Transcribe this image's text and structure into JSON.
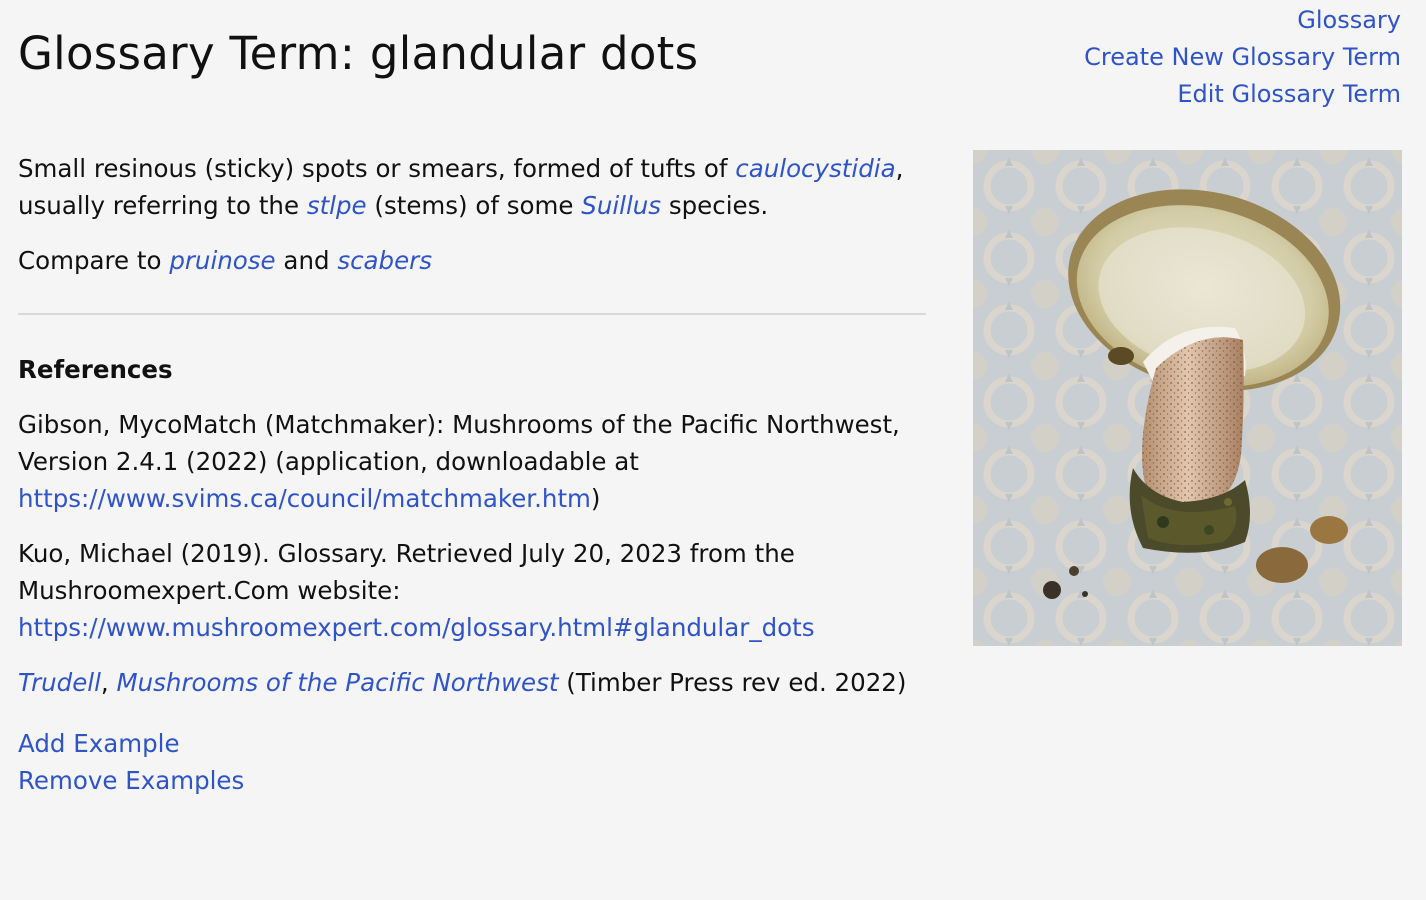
{
  "title": "Glossary Term: glandular dots",
  "nav": {
    "glossary": "Glossary",
    "create": "Create New Glossary Term",
    "edit": "Edit Glossary Term"
  },
  "definition": {
    "t1": "Small resinous (sticky) spots or smears, formed of tufts of ",
    "link_caulocystidia": "caulocystidia",
    "t2": ", usually referring to the ",
    "link_stipe": "stlpe",
    "t3": " (stems) of some ",
    "link_suillus": "Suillus",
    "t4": " species."
  },
  "compare": {
    "t1": "Compare to ",
    "link_pruinose": "pruinose",
    "t2": " and ",
    "link_scabers": "scabers"
  },
  "references": {
    "heading": "References",
    "ref1": {
      "text": "Gibson, MycoMatch (Matchmaker): Mushrooms of the Pacific Northwest, Version 2.4.1 (2022) (application, downloadable at ",
      "url": "https://www.svims.ca/council/matchmaker.htm",
      "tail": ")"
    },
    "ref2": {
      "text": "Kuo, Michael (2019). Glossary. Retrieved July 20, 2023 from the Mushroomexpert.Com website: ",
      "url": "https://www.mushroomexpert.com/glossary.html#glandular_dots"
    },
    "ref3": {
      "author": "Trudell",
      "sep": ", ",
      "book": "Mushrooms of the Pacific Northwest",
      "tail": " (Timber Press rev ed. 2022)"
    }
  },
  "actions": {
    "add": "Add Example",
    "remove": "Remove Examples"
  },
  "colors": {
    "link": "#2f54c9",
    "background": "#f5f5f5",
    "divider": "#d8d8d8"
  }
}
